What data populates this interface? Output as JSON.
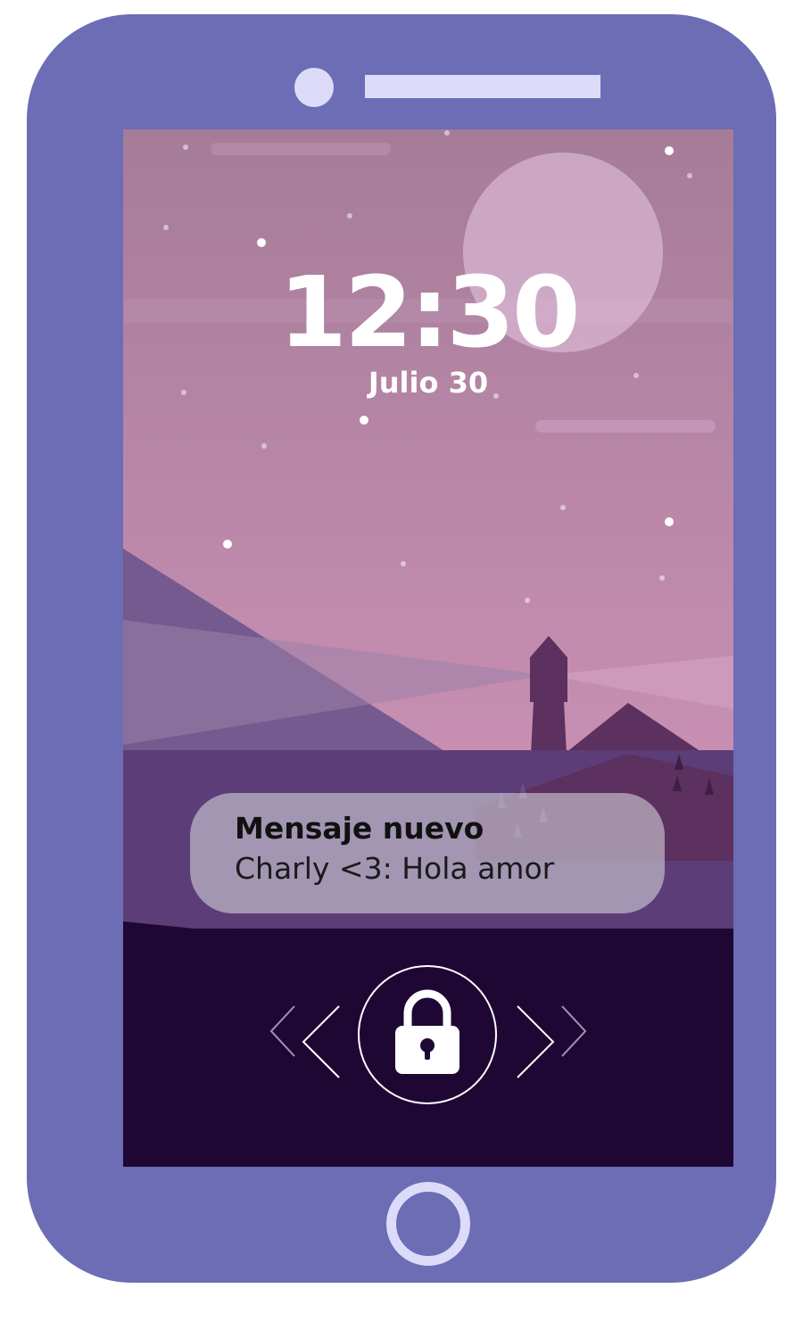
{
  "lockscreen": {
    "time": "12:30",
    "date": "Julio 30"
  },
  "notification": {
    "title": "Mensaje nuevo",
    "body": "Charly <3: Hola amor"
  },
  "icons": {
    "lock": "padlock-icon",
    "unlock_left": "double-chevron-left-icon",
    "unlock_right": "double-chevron-right-icon",
    "home": "home-button-ring"
  },
  "colors": {
    "phone_body": "#6c6db4",
    "phone_accent": "#dcdcfa",
    "sky_top": "#a57c98",
    "sky_bottom": "#c88fb3",
    "ground_dark": "#1f0734",
    "notification_bg": "#cdcdd7"
  }
}
